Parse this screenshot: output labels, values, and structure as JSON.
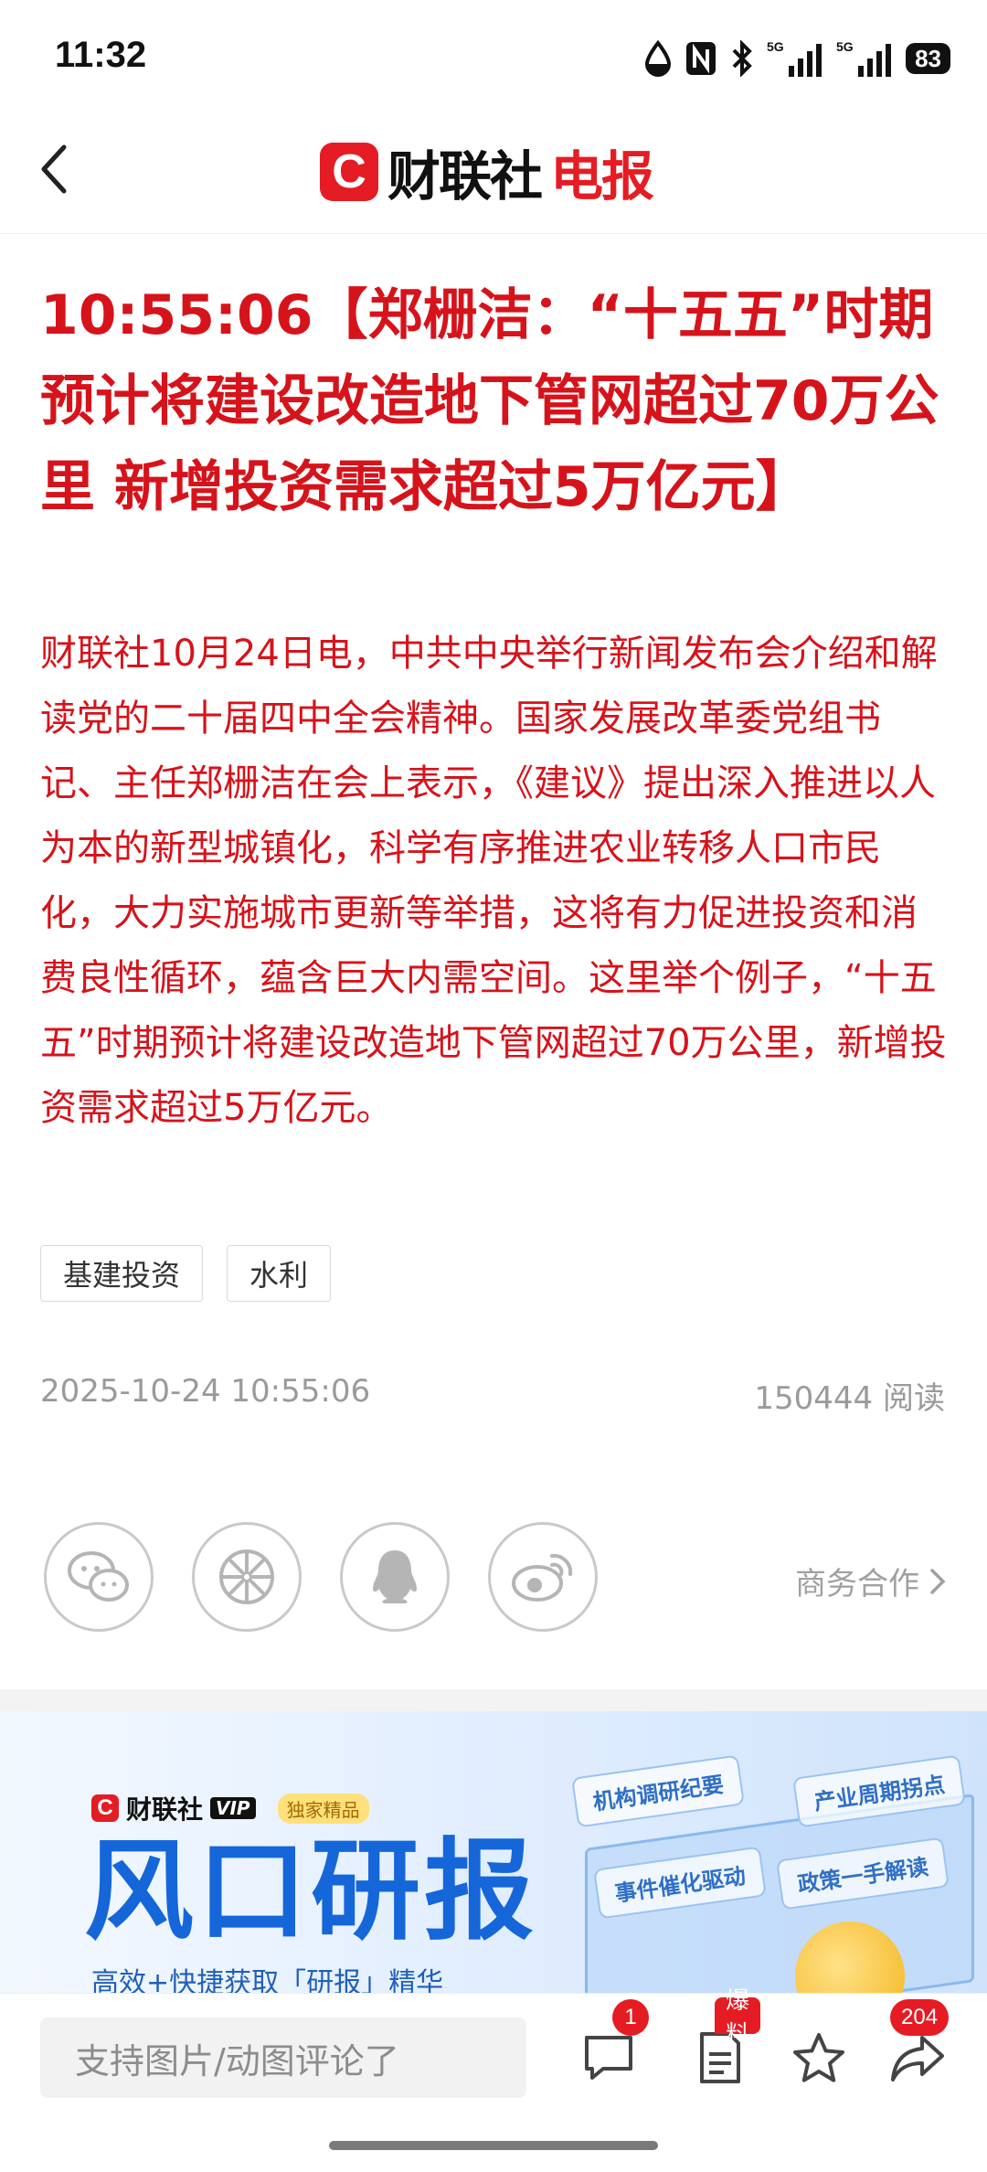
{
  "status_bar": {
    "time": "11:32",
    "battery": "83",
    "icons": [
      "dnd-drop-icon",
      "nfc-icon",
      "bluetooth-icon",
      "signal-5g-icon",
      "signal-5g-icon"
    ]
  },
  "header": {
    "logo_mark": "C",
    "logo_text_a": "财联社",
    "logo_text_b": "电报",
    "back_icon": "chevron-left-icon"
  },
  "article": {
    "headline": "10:55:06【郑栅洁：“十五五”时期预计将建设改造地下管网超过70万公里 新增投资需求超过5万亿元】",
    "body": "财联社10月24日电，中共中央举行新闻发布会介绍和解读党的二十届四中全会精神。国家发展改革委党组书记、主任郑栅洁在会上表示，《建议》提出深入推进以人为本的新型城镇化，科学有序推进农业转移人口市民化，大力实施城市更新等举措，这将有力促进投资和消费良性循环，蕴含巨大内需空间。这里举个例子，“十五五”时期预计将建设改造地下管网超过70万公里，新增投资需求超过5万亿元。",
    "tags": [
      "基建投资",
      "水利"
    ],
    "datetime": "2025-10-24 10:55:06",
    "reads": "150444 阅读"
  },
  "share": {
    "buttons": [
      "wechat-icon",
      "moments-icon",
      "qq-icon",
      "weibo-icon"
    ],
    "business_label": "商务合作"
  },
  "banner": {
    "brand_mark": "C",
    "brand_text": "财联社",
    "vip": "VIP",
    "exclusive": "独家精品",
    "title": "风口研报",
    "subtitle": "高效+快捷获取「研报」精华",
    "tiles": [
      "机构调研纪要",
      "产业周期拐点",
      "事件催化驱动",
      "政策一手解读"
    ]
  },
  "bottom_bar": {
    "comment_placeholder": "支持图片/动图评论了",
    "comment_badge": "1",
    "tipoff_badge": "爆料",
    "share_badge": "204"
  },
  "colors": {
    "brand_red": "#e51c23",
    "headline_red": "#d6131b",
    "banner_blue": "#1566d9"
  }
}
